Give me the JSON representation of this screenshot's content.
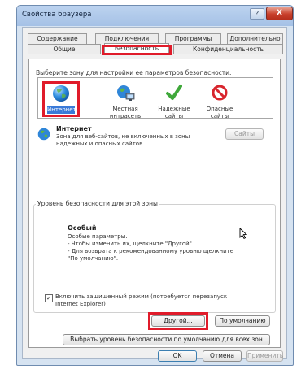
{
  "window": {
    "title": "Свойства браузера",
    "help_glyph": "?",
    "close_glyph": "X"
  },
  "tabs": {
    "row1": [
      "Содержание",
      "Подключения",
      "Программы",
      "Дополнительно"
    ],
    "row2": [
      "Общие",
      "Безопасность",
      "Конфиденциальность"
    ]
  },
  "security": {
    "zone_prompt": "Выберите зону для настройки ее параметров безопасности.",
    "zones": [
      {
        "label": "Интернет",
        "icon": "globe-icon",
        "selected": true
      },
      {
        "label": "Местная интрасеть",
        "icon": "intranet-icon"
      },
      {
        "label": "Надежные сайты",
        "icon": "checkmark-icon"
      },
      {
        "label": "Опасные сайты",
        "icon": "restricted-icon"
      }
    ],
    "zone_info": {
      "title": "Интернет",
      "description": "Зона для веб-сайтов, не включенных в зоны надежных и опасных сайтов."
    },
    "sites_button": "Сайты",
    "level_group": {
      "legend": "Уровень безопасности для этой зоны",
      "level_title": "Особый",
      "lines": [
        "Особые параметры.",
        "- Чтобы изменить их, щелкните \"Другой\".",
        "- Для возврата к рекомендованному уровню щелкните",
        "\"По умолчанию\"."
      ],
      "protected_mode": {
        "checked": true,
        "label": "Включить защищенный режим (потребуется перезапуск Internet Explorer)"
      },
      "custom_button": "Другой...",
      "default_button": "По умолчанию"
    },
    "reset_all_button": "Выбрать уровень безопасности по умолчанию для всех зон"
  },
  "footer": {
    "ok": "OK",
    "cancel": "Отмена",
    "apply": "Применить"
  },
  "colors": {
    "highlight": "#e01b2a",
    "selection": "#3a7ad8"
  }
}
